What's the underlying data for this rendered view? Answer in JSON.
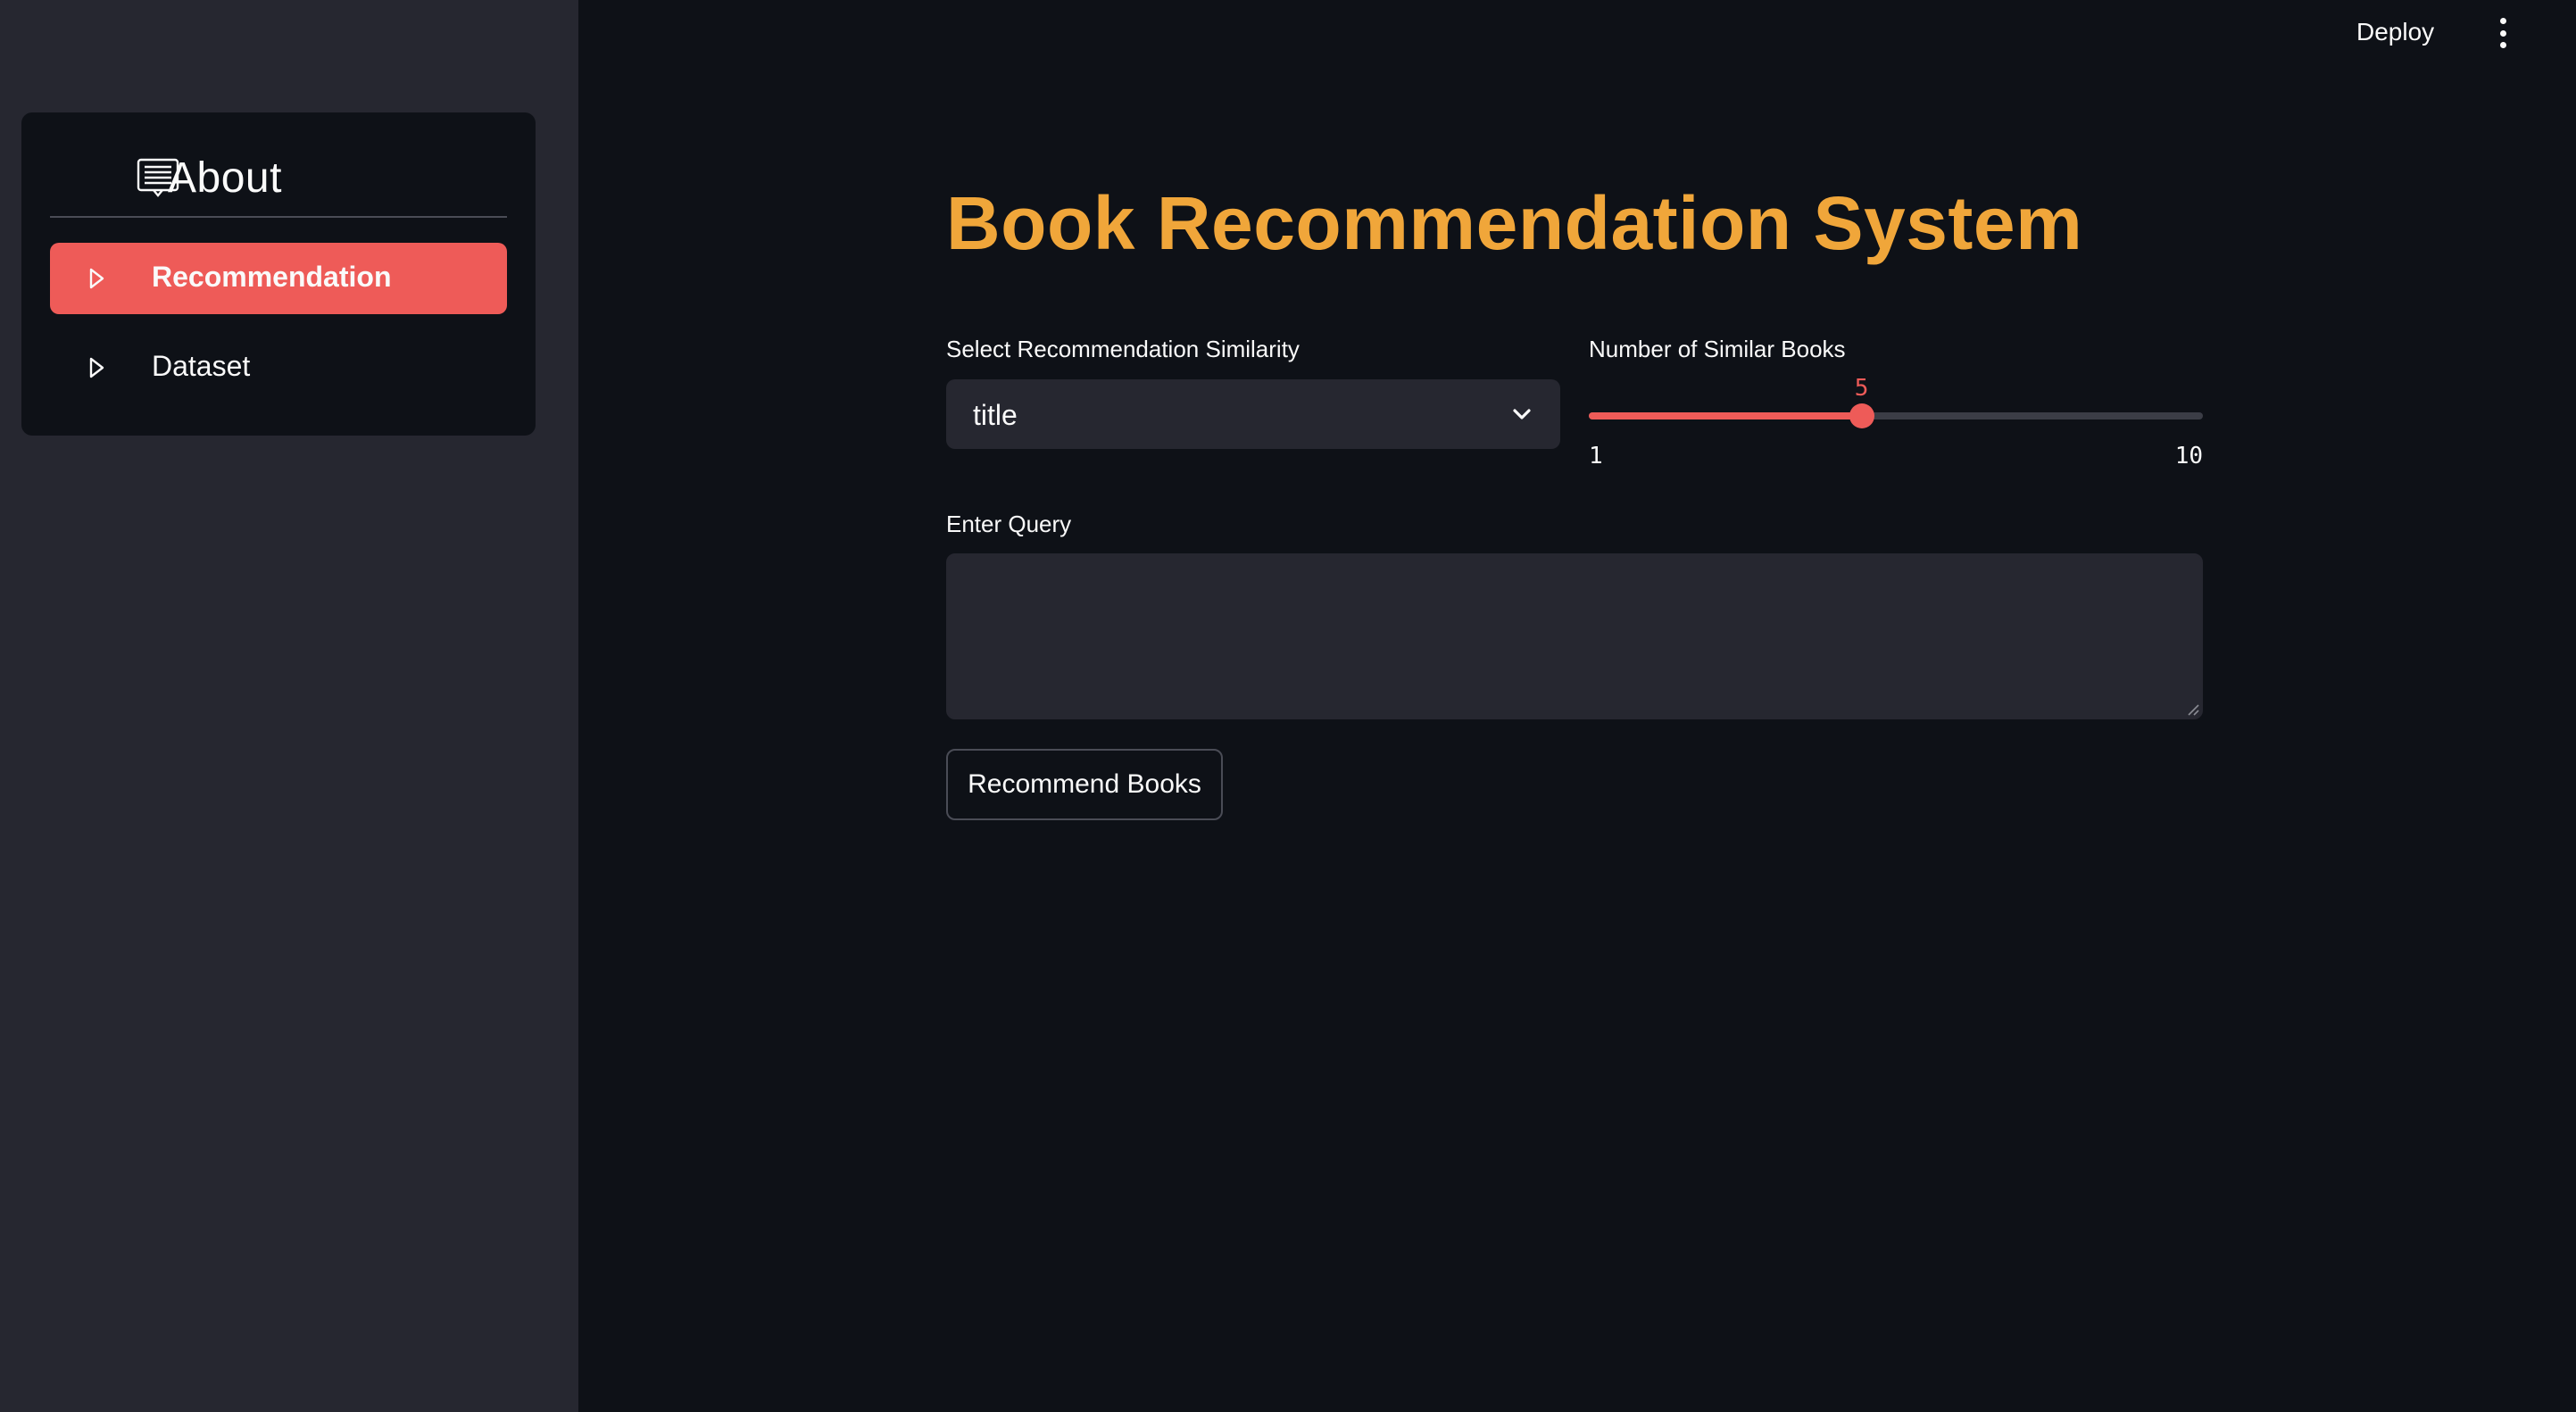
{
  "sidebar": {
    "title": "About",
    "title_icon": "message-card-icon",
    "items": [
      {
        "label": "Recommendation",
        "icon": "caret-right-icon",
        "active": true
      },
      {
        "label": "Dataset",
        "icon": "caret-right-icon",
        "active": false
      }
    ]
  },
  "header": {
    "deploy_label": "Deploy",
    "menu_icon": "kebab-menu-icon"
  },
  "main": {
    "title": "Book Recommendation System",
    "similarity": {
      "label": "Select Recommendation Similarity",
      "value": "title"
    },
    "slider": {
      "label": "Number of Similar Books",
      "value": "5",
      "min": "1",
      "max": "10"
    },
    "query": {
      "label": "Enter Query",
      "value": ""
    },
    "button_label": "Recommend Books"
  },
  "colors": {
    "background": "#0e1117",
    "sidebar": "#262730",
    "accent": "#ee5b58",
    "title": "#f0a63a"
  }
}
